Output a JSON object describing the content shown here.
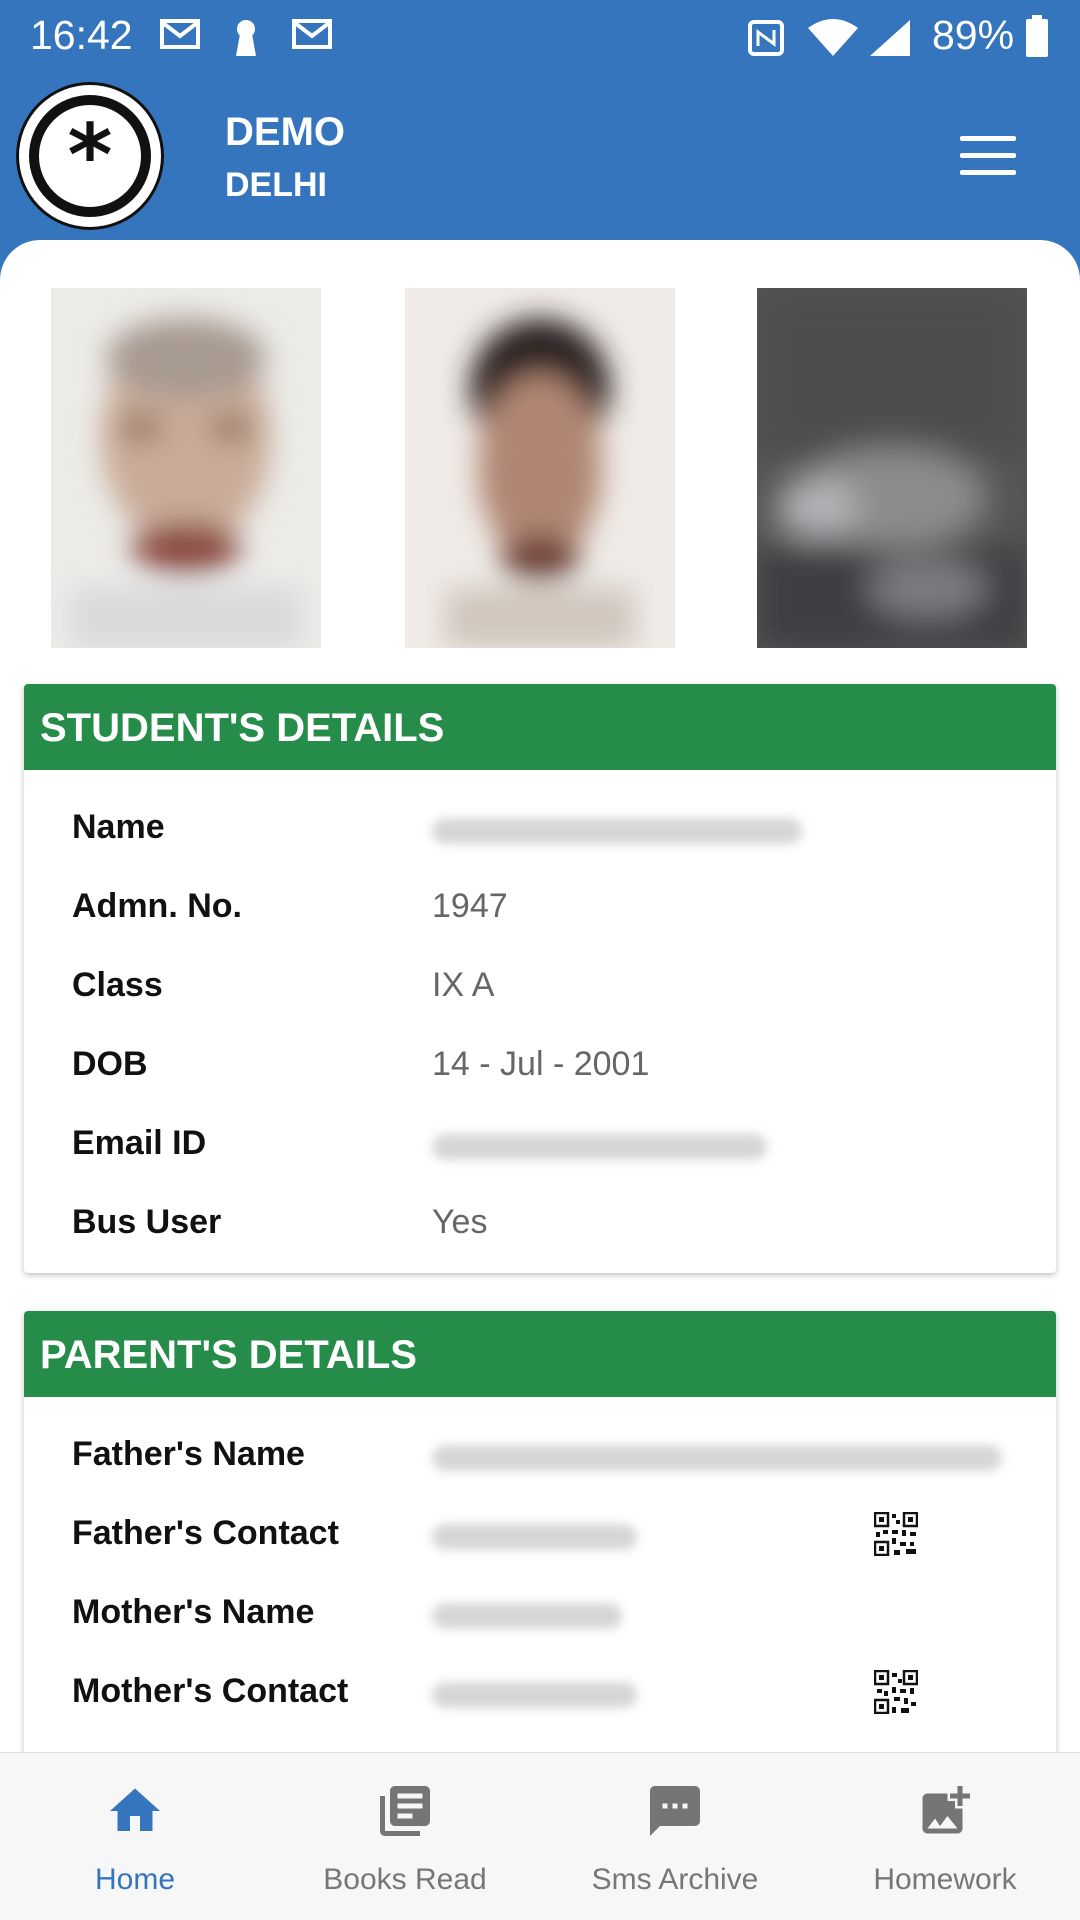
{
  "status_bar": {
    "time": "16:42",
    "battery": "89%"
  },
  "header": {
    "org_name": "DEMO",
    "org_city": "DELHI"
  },
  "students_details": {
    "title": "STUDENT'S DETAILS",
    "rows": [
      {
        "label": "Name",
        "value": ""
      },
      {
        "label": "Admn. No.",
        "value": "1947"
      },
      {
        "label": "Class",
        "value": "IX A"
      },
      {
        "label": "DOB",
        "value": "14 - Jul - 2001"
      },
      {
        "label": "Email ID",
        "value": ""
      },
      {
        "label": "Bus User",
        "value": "Yes"
      }
    ]
  },
  "parents_details": {
    "title": "PARENT'S DETAILS",
    "rows": [
      {
        "label": "Father's Name",
        "value": ""
      },
      {
        "label": "Father's Contact",
        "value": ""
      },
      {
        "label": "Mother's Name",
        "value": ""
      },
      {
        "label": "Mother's Contact",
        "value": ""
      }
    ]
  },
  "bottom_nav": [
    {
      "label": "Home",
      "icon": "home-icon",
      "active": true
    },
    {
      "label": "Books Read",
      "icon": "library-books-icon",
      "active": false
    },
    {
      "label": "Sms Archive",
      "icon": "chat-bubble-icon",
      "active": false
    },
    {
      "label": "Homework",
      "icon": "image-upload-icon",
      "active": false
    }
  ],
  "colors": {
    "primary": "#3575bd",
    "section_header": "#268c4a",
    "nav_inactive": "#777777"
  }
}
